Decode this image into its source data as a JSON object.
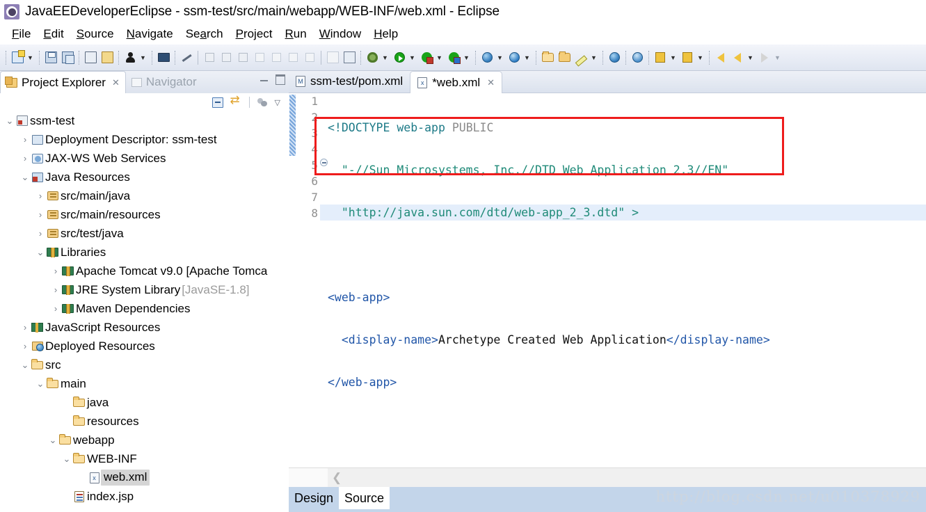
{
  "window": {
    "title": "JavaEEDeveloperEclipse - ssm-test/src/main/webapp/WEB-INF/web.xml - Eclipse",
    "app_icon": "eclipse-icon"
  },
  "menubar": {
    "items": [
      {
        "label": "File",
        "mnemonic": "F"
      },
      {
        "label": "Edit",
        "mnemonic": "E"
      },
      {
        "label": "Source",
        "mnemonic": "S"
      },
      {
        "label": "Navigate",
        "mnemonic": "N"
      },
      {
        "label": "Search",
        "mnemonic": "a"
      },
      {
        "label": "Project",
        "mnemonic": "P"
      },
      {
        "label": "Run",
        "mnemonic": "R"
      },
      {
        "label": "Window",
        "mnemonic": "W"
      },
      {
        "label": "Help",
        "mnemonic": "H"
      }
    ]
  },
  "toolbar": {
    "groups": [
      {
        "items": [
          {
            "icon": "new-wizard-icon",
            "arrow": true
          }
        ]
      },
      {
        "items": [
          {
            "icon": "save-icon",
            "arrow": false
          },
          {
            "icon": "save-all-icon",
            "arrow": false
          }
        ]
      },
      {
        "items": [
          {
            "icon": "print-icon",
            "arrow": false
          },
          {
            "icon": "validate-icon",
            "arrow": false
          }
        ]
      },
      {
        "items": [
          {
            "icon": "person-icon",
            "arrow": true
          }
        ]
      },
      {
        "items": [
          {
            "icon": "console-icon",
            "arrow": false
          }
        ]
      },
      {
        "items": [
          {
            "icon": "skip-breakpoints-icon",
            "arrow": false
          }
        ]
      },
      {
        "items": [
          {
            "icon": "resume-icon",
            "arrow": false
          },
          {
            "icon": "suspend-icon",
            "arrow": false
          },
          {
            "icon": "terminate-icon",
            "arrow": false
          },
          {
            "icon": "disconnect-icon",
            "arrow": false
          },
          {
            "icon": "step-into-icon",
            "arrow": false
          },
          {
            "icon": "step-over-icon",
            "arrow": false
          },
          {
            "icon": "step-return-icon",
            "arrow": false
          }
        ]
      },
      {
        "items": [
          {
            "icon": "toggle-markoccurrences-icon",
            "arrow": false
          },
          {
            "icon": "profile-icon",
            "arrow": false
          }
        ]
      },
      {
        "items": [
          {
            "icon": "debug-icon",
            "arrow": true
          },
          {
            "icon": "run-icon",
            "arrow": true
          },
          {
            "icon": "run-on-server-icon",
            "arrow": true
          },
          {
            "icon": "stop-server-icon",
            "arrow": true
          }
        ]
      },
      {
        "items": [
          {
            "icon": "new-java-project-icon",
            "arrow": true
          },
          {
            "icon": "search-scope-icon",
            "arrow": true
          }
        ]
      },
      {
        "items": [
          {
            "icon": "open-type-icon",
            "arrow": false
          },
          {
            "icon": "open-task-icon",
            "arrow": false
          },
          {
            "icon": "marker-icon",
            "arrow": true
          }
        ]
      },
      {
        "items": [
          {
            "icon": "web-browser-icon",
            "arrow": false
          }
        ]
      },
      {
        "items": [
          {
            "icon": "open-perspective-icon",
            "arrow": false
          }
        ]
      },
      {
        "items": [
          {
            "icon": "previous-annotation-icon",
            "arrow": true
          },
          {
            "icon": "next-annotation-icon",
            "arrow": true
          }
        ]
      },
      {
        "items": [
          {
            "icon": "back-history-icon",
            "arrow": false
          },
          {
            "icon": "back-icon",
            "arrow": true
          },
          {
            "icon": "forward-icon",
            "arrow": true
          }
        ]
      }
    ]
  },
  "left_panel": {
    "tabs": [
      {
        "label": "Project Explorer",
        "icon": "project-explorer-icon",
        "active": true,
        "closable": true
      },
      {
        "label": "Navigator",
        "icon": "navigator-icon",
        "active": false,
        "closable": false
      }
    ],
    "toolbar_icons": [
      "collapse-all-icon",
      "link-with-editor-icon",
      "view-filters-icon",
      "view-menu-icon"
    ],
    "window_controls": [
      "minimize-icon",
      "maximize-icon"
    ],
    "tree": [
      {
        "label": "ssm-test",
        "indent": 0,
        "twisty": "down",
        "icon": "maven-project-icon",
        "selected": false
      },
      {
        "label": "Deployment Descriptor: ssm-test",
        "indent": 1,
        "twisty": "right",
        "icon": "deployment-descriptor-icon",
        "selected": false
      },
      {
        "label": "JAX-WS Web Services",
        "indent": 1,
        "twisty": "right",
        "icon": "jaxws-icon",
        "selected": false
      },
      {
        "label": "Java Resources",
        "indent": 1,
        "twisty": "down",
        "icon": "java-resources-icon",
        "selected": false
      },
      {
        "label": "src/main/java",
        "indent": 2,
        "twisty": "right",
        "icon": "source-folder-icon",
        "selected": false
      },
      {
        "label": "src/main/resources",
        "indent": 2,
        "twisty": "right",
        "icon": "source-folder-icon",
        "selected": false
      },
      {
        "label": "src/test/java",
        "indent": 2,
        "twisty": "right",
        "icon": "source-folder-icon",
        "selected": false
      },
      {
        "label": "Libraries",
        "indent": 2,
        "twisty": "down",
        "icon": "library-icon",
        "selected": false
      },
      {
        "label": "Apache Tomcat v9.0 [Apache Tomca",
        "indent": 3,
        "twisty": "right",
        "icon": "library-icon",
        "selected": false
      },
      {
        "label": "JRE System Library",
        "secondary": "[JavaSE-1.8]",
        "indent": 3,
        "twisty": "right",
        "icon": "library-icon",
        "selected": false
      },
      {
        "label": "Maven Dependencies",
        "indent": 3,
        "twisty": "right",
        "icon": "library-icon",
        "selected": false
      },
      {
        "label": "JavaScript Resources",
        "indent": 1,
        "twisty": "right",
        "icon": "javascript-resources-icon",
        "selected": false
      },
      {
        "label": "Deployed Resources",
        "indent": 1,
        "twisty": "right",
        "icon": "deployed-resources-icon",
        "selected": false
      },
      {
        "label": "src",
        "indent": 1,
        "twisty": "down",
        "icon": "folder-icon",
        "selected": false
      },
      {
        "label": "main",
        "indent": 2,
        "twisty": "down",
        "icon": "folder-icon",
        "selected": false
      },
      {
        "label": "java",
        "indent": 3,
        "twisty": "none",
        "icon": "folder-icon",
        "selected": false
      },
      {
        "label": "resources",
        "indent": 3,
        "twisty": "none",
        "icon": "folder-icon",
        "selected": false
      },
      {
        "label": "webapp",
        "indent": 3,
        "twisty": "down",
        "icon": "folder-icon",
        "selected": false
      },
      {
        "label": "WEB-INF",
        "indent": 4,
        "twisty": "down",
        "icon": "folder-icon",
        "selected": false
      },
      {
        "label": "web.xml",
        "indent": 5,
        "twisty": "none",
        "icon": "xml-file-icon",
        "selected": true
      },
      {
        "label": "index.jsp",
        "indent": 4,
        "twisty": "none",
        "icon": "jsp-file-icon",
        "selected": false
      }
    ]
  },
  "editor": {
    "tabs": [
      {
        "label": "ssm-test/pom.xml",
        "icon": "maven-pom-icon",
        "active": false,
        "dirty": false,
        "closable": false
      },
      {
        "label": "*web.xml",
        "icon": "xml-file-icon",
        "active": true,
        "dirty": true,
        "closable": true
      }
    ],
    "line_numbers": [
      "1",
      "2",
      "3",
      "4",
      "5",
      "6",
      "7",
      "8"
    ],
    "highlighted_line": 3,
    "folding_line": 5,
    "code": [
      {
        "n": "1",
        "tokens": [
          {
            "t": "<!DOCTYPE ",
            "c": "tag"
          },
          {
            "t": "web-app",
            "c": "tag"
          },
          {
            "t": " PUBLIC",
            "c": "name"
          }
        ]
      },
      {
        "n": "2",
        "tokens": [
          {
            "t": "  \"-//Sun Microsystems, Inc.//DTD Web Application 2.3//EN\"",
            "c": "str"
          }
        ]
      },
      {
        "n": "3",
        "tokens": [
          {
            "t": "  \"http://java.sun.com/dtd/web-app_2_3.dtd\" >",
            "c": "str"
          }
        ]
      },
      {
        "n": "4",
        "tokens": [
          {
            "t": "",
            "c": "text"
          }
        ]
      },
      {
        "n": "5",
        "tokens": [
          {
            "t": "<web-app>",
            "c": "tagblue"
          }
        ]
      },
      {
        "n": "6",
        "tokens": [
          {
            "t": "  <display-name>",
            "c": "tagblue"
          },
          {
            "t": "Archetype Created Web Application",
            "c": "text"
          },
          {
            "t": "</display-name>",
            "c": "tagblue"
          }
        ]
      },
      {
        "n": "7",
        "tokens": [
          {
            "t": "</web-app>",
            "c": "tagblue"
          }
        ]
      },
      {
        "n": "8",
        "tokens": [
          {
            "t": "",
            "c": "text"
          }
        ]
      }
    ],
    "annotation_box": {
      "color": "#ee1c1c",
      "label": "doctype-highlight-box"
    },
    "bottom_tabs": [
      {
        "label": "Design",
        "active": false
      },
      {
        "label": "Source",
        "active": true
      }
    ],
    "hscroll_arrow": "scroll-left-icon"
  },
  "watermark": {
    "text": "http://blog.csdn.net/u010378929"
  },
  "colors": {
    "accent": "#2156a8",
    "annotation_red": "#ee1c1c",
    "string_green": "#1f8a78",
    "tag_teal": "#1d7a87",
    "selection_gray": "#d5d5d5",
    "line_highlight": "#e4eefb",
    "bottom_tab_bg": "#c3d5ea"
  }
}
